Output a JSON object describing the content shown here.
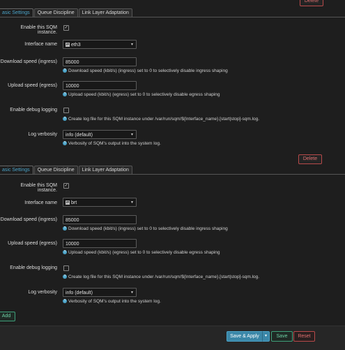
{
  "instances": [
    {
      "delete_label": "Delete",
      "tabs": [
        "asic Settings",
        "Queue Discipline",
        "Link Layer Adaptation"
      ],
      "enable_label": "Enable this SQM instance.",
      "enable_checked": "✓",
      "interface_label": "Interface name",
      "interface_value": "eth3",
      "download_label": "Download speed (ingress)",
      "download_value": "85000",
      "download_help": "Download speed (kbit/s) (ingress) set to 0 to selectively disable ingress shaping",
      "upload_label": "Upload speed (egress)",
      "upload_value": "10000",
      "upload_help": "Upload speed (kbit/s) (egress) set to 0 to selectively disable egress shaping",
      "debug_label": "Enable debug logging",
      "debug_help": "Create log file for this SQM instance under /var/run/sqm/${Interface_name}.[start|stop]-sqm.log.",
      "verbosity_label": "Log verbosity",
      "verbosity_value": "info (default)",
      "verbosity_help": "Verbosity of SQM's output into the system log."
    },
    {
      "delete_label": "Delete",
      "tabs": [
        "asic Settings",
        "Queue Discipline",
        "Link Layer Adaptation"
      ],
      "enable_label": "Enable this SQM instance.",
      "enable_checked": "✓",
      "interface_label": "Interface name",
      "interface_value": "brt",
      "download_label": "Download speed (ingress)",
      "download_value": "85000",
      "download_help": "Download speed (kbit/s) (ingress) set to 0 to selectively disable ingress shaping",
      "upload_label": "Upload speed (egress)",
      "upload_value": "10000",
      "upload_help": "Upload speed (kbit/s) (egress) set to 0 to selectively disable egress shaping",
      "debug_label": "Enable debug logging",
      "debug_help": "Create log file for this SQM instance under /var/run/sqm/${Interface_name}.[start|stop]-sqm.log.",
      "verbosity_label": "Log verbosity",
      "verbosity_value": "info (default)",
      "verbosity_help": "Verbosity of SQM's output into the system log."
    }
  ],
  "add_label": "Add",
  "footer": {
    "save_apply_label": "Save & Apply",
    "save_label": "Save",
    "reset_label": "Reset"
  },
  "icons": {
    "help": "question-circle-icon",
    "interface": "network-interface-icon",
    "dropdown": "chevron-down-icon",
    "check": "checkmark-icon"
  },
  "colors": {
    "accent": "#4aa3c8",
    "danger": "#e07070",
    "success": "#6fd0a5",
    "background": "#1e1e1e"
  }
}
